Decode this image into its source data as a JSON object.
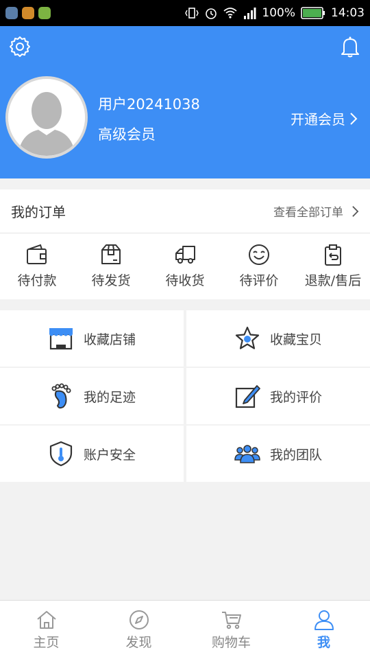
{
  "status_bar": {
    "battery": "100%",
    "time": "14:03",
    "app_icons": [
      "browser-icon",
      "app-icon",
      "android-icon"
    ]
  },
  "header": {
    "bg_color": "#3d8ef5",
    "username": "用户20241038",
    "level": "高级会员",
    "vip_link": "开通会员"
  },
  "orders": {
    "title": "我的订单",
    "view_all": "查看全部订单",
    "items": [
      {
        "label": "待付款",
        "icon": "wallet-icon"
      },
      {
        "label": "待发货",
        "icon": "package-icon"
      },
      {
        "label": "待收货",
        "icon": "truck-icon"
      },
      {
        "label": "待评价",
        "icon": "smile-icon"
      },
      {
        "label": "退款/售后",
        "icon": "clipboard-return-icon"
      }
    ]
  },
  "menu": [
    {
      "label": "收藏店铺",
      "icon": "store-icon"
    },
    {
      "label": "收藏宝贝",
      "icon": "star-icon"
    },
    {
      "label": "我的足迹",
      "icon": "footprint-icon"
    },
    {
      "label": "我的评价",
      "icon": "edit-icon"
    },
    {
      "label": "账户安全",
      "icon": "shield-icon"
    },
    {
      "label": "我的团队",
      "icon": "team-icon"
    }
  ],
  "tabs": [
    {
      "label": "主页",
      "icon": "home-icon"
    },
    {
      "label": "发现",
      "icon": "compass-icon"
    },
    {
      "label": "购物车",
      "icon": "cart-icon"
    },
    {
      "label": "我",
      "icon": "user-icon",
      "active": true
    }
  ]
}
